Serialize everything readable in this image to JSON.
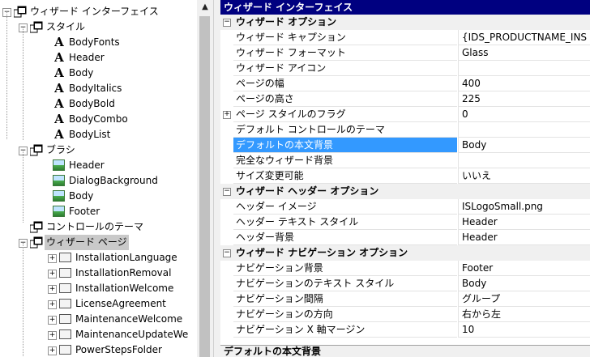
{
  "tree": {
    "nodes": [
      {
        "label": "ウィザード インターフェイス",
        "icon": "folder-icon",
        "indent": 0,
        "expander": "−"
      },
      {
        "label": "スタイル",
        "icon": "folder-icon",
        "indent": 1,
        "expander": "−"
      },
      {
        "label": "BodyFonts",
        "icon": "font-icon",
        "indent": 2,
        "expander": ""
      },
      {
        "label": "Header",
        "icon": "font-icon",
        "indent": 2,
        "expander": ""
      },
      {
        "label": "Body",
        "icon": "font-icon",
        "indent": 2,
        "expander": ""
      },
      {
        "label": "BodyItalics",
        "icon": "font-icon",
        "indent": 2,
        "expander": ""
      },
      {
        "label": "BodyBold",
        "icon": "font-icon",
        "indent": 2,
        "expander": ""
      },
      {
        "label": "BodyCombo",
        "icon": "font-icon",
        "indent": 2,
        "expander": ""
      },
      {
        "label": "BodyList",
        "icon": "font-icon",
        "indent": 2,
        "expander": ""
      },
      {
        "label": "ブラシ",
        "icon": "folder-icon",
        "indent": 1,
        "expander": "−"
      },
      {
        "label": "Header",
        "icon": "image-icon",
        "indent": 2,
        "expander": ""
      },
      {
        "label": "DialogBackground",
        "icon": "image-icon",
        "indent": 2,
        "expander": ""
      },
      {
        "label": "Body",
        "icon": "image-icon",
        "indent": 2,
        "expander": ""
      },
      {
        "label": "Footer",
        "icon": "image-icon",
        "indent": 2,
        "expander": ""
      },
      {
        "label": "コントロールのテーマ",
        "icon": "folder-icon",
        "indent": 1,
        "expander": ""
      },
      {
        "label": "ウィザード ページ",
        "icon": "folder-icon",
        "indent": 1,
        "expander": "−",
        "selected": true
      },
      {
        "label": "InstallationLanguage",
        "icon": "page-icon",
        "indent": 2,
        "expander": "+"
      },
      {
        "label": "InstallationRemoval",
        "icon": "page-icon",
        "indent": 2,
        "expander": "+"
      },
      {
        "label": "InstallationWelcome",
        "icon": "page-icon",
        "indent": 2,
        "expander": "+"
      },
      {
        "label": "LicenseAgreement",
        "icon": "page-icon",
        "indent": 2,
        "expander": "+"
      },
      {
        "label": "MaintenanceWelcome",
        "icon": "page-icon",
        "indent": 2,
        "expander": "+"
      },
      {
        "label": "MaintenanceUpdateWe",
        "icon": "page-icon",
        "indent": 2,
        "expander": "+"
      },
      {
        "label": "PowerStepsFolder",
        "icon": "page-icon",
        "indent": 2,
        "expander": "+"
      }
    ]
  },
  "grid": {
    "title": "ウィザード インターフェイス",
    "rows": [
      {
        "kind": "cat",
        "name": "ウィザード オプション",
        "exp": "−"
      },
      {
        "kind": "prop",
        "name": "ウィザード キャプション",
        "value": "{IDS_PRODUCTNAME_INS"
      },
      {
        "kind": "prop",
        "name": "ウィザード フォーマット",
        "value": "Glass"
      },
      {
        "kind": "prop",
        "name": "ウィザード アイコン",
        "value": ""
      },
      {
        "kind": "prop",
        "name": "ページの幅",
        "value": "400"
      },
      {
        "kind": "prop",
        "name": "ページの高さ",
        "value": "225"
      },
      {
        "kind": "prop",
        "name": "ページ スタイルのフラグ",
        "value": "0",
        "exp": "+"
      },
      {
        "kind": "prop",
        "name": "デフォルト コントロールのテーマ",
        "value": ""
      },
      {
        "kind": "prop",
        "name": "デフォルトの本文背景",
        "value": "Body",
        "selected": true
      },
      {
        "kind": "prop",
        "name": "完全なウィザード背景",
        "value": ""
      },
      {
        "kind": "prop",
        "name": "サイズ変更可能",
        "value": "いいえ"
      },
      {
        "kind": "cat",
        "name": "ウィザード ヘッダー オプション",
        "exp": "−"
      },
      {
        "kind": "prop",
        "name": "ヘッダー イメージ",
        "value": "ISLogoSmall.png"
      },
      {
        "kind": "prop",
        "name": "ヘッダー テキスト スタイル",
        "value": "Header"
      },
      {
        "kind": "prop",
        "name": "ヘッダー背景",
        "value": "Header"
      },
      {
        "kind": "cat",
        "name": "ウィザード ナビゲーション オプション",
        "exp": "−"
      },
      {
        "kind": "prop",
        "name": "ナビゲーション背景",
        "value": "Footer"
      },
      {
        "kind": "prop",
        "name": "ナビゲーションのテキスト スタイル",
        "value": "Body"
      },
      {
        "kind": "prop",
        "name": "ナビゲーション間隔",
        "value": "グループ"
      },
      {
        "kind": "prop",
        "name": "ナビゲーションの方向",
        "value": "右から左"
      },
      {
        "kind": "prop",
        "name": "ナビゲーション X 軸マージン",
        "value": "10"
      }
    ],
    "description_title": "デフォルトの本文背景"
  },
  "colors": {
    "title_bar": "#000080",
    "selection": "#3399ff",
    "tree_selection": "#c9c9c9"
  }
}
